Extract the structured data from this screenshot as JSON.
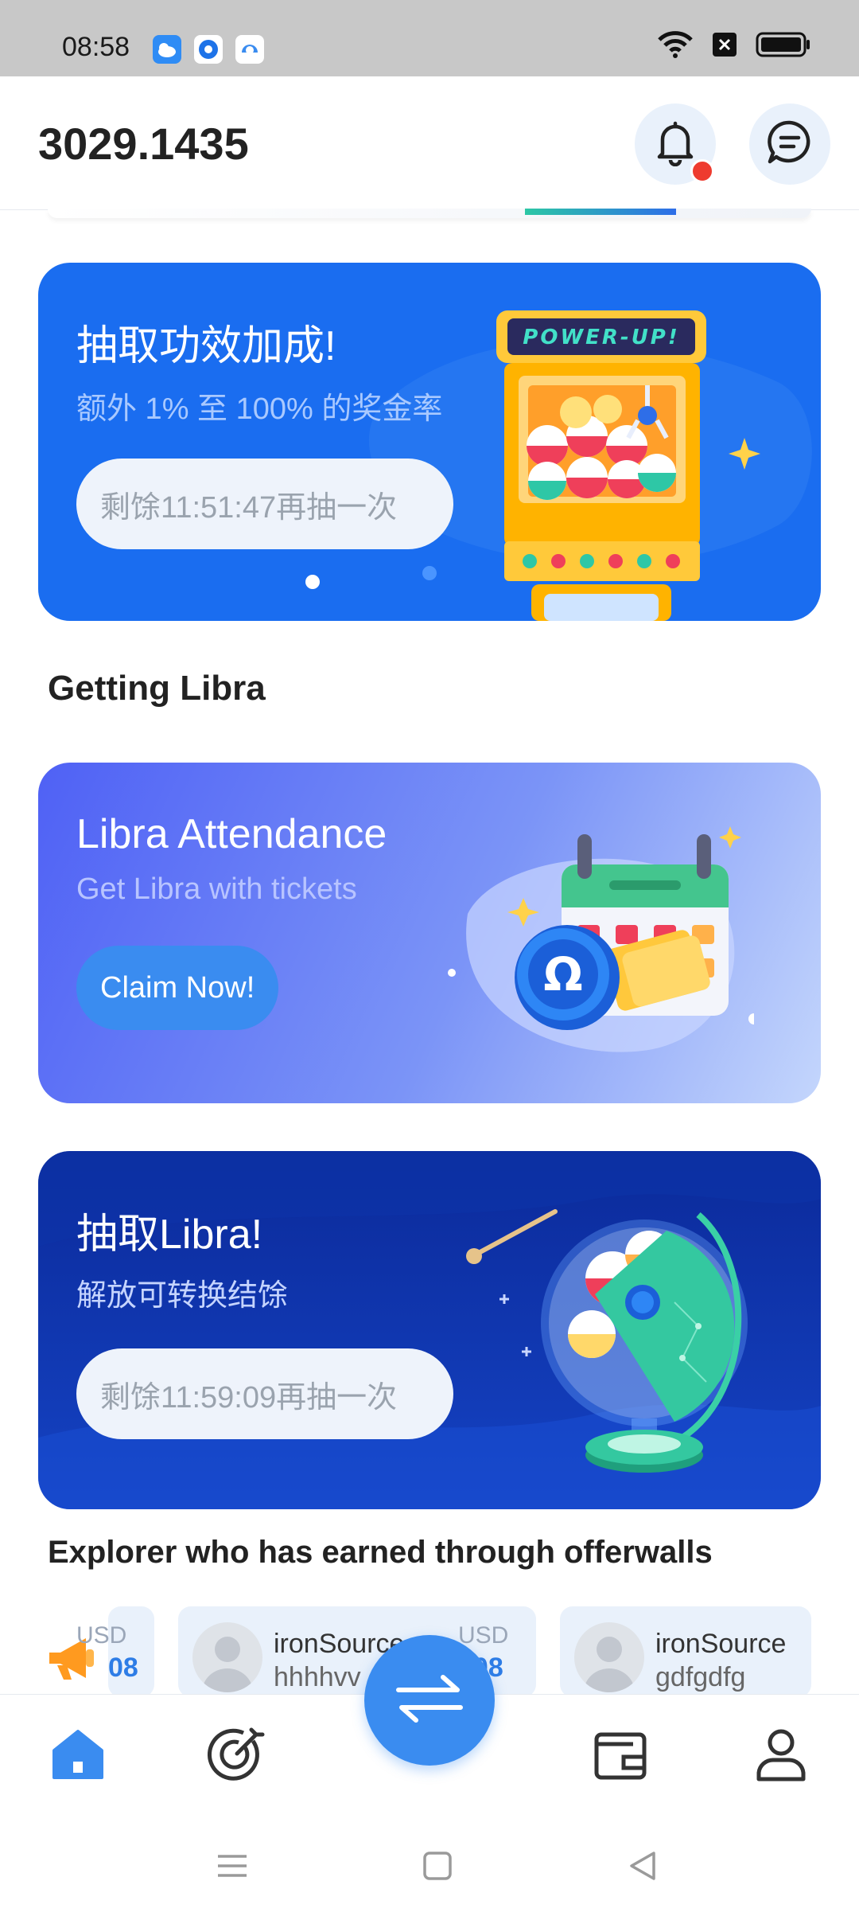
{
  "status_bar": {
    "time": "08:58"
  },
  "header": {
    "balance": "3029.1435"
  },
  "banners": {
    "power_up": {
      "title": "抽取功效加成!",
      "subtitle": "额外 1% 至 100% 的奖金率",
      "button": "剩馀11:51:47再抽一次",
      "machine_sign": "POWER-UP!"
    },
    "getting_title": "Getting Libra",
    "attendance": {
      "title": "Libra Attendance",
      "subtitle": "Get Libra with tickets",
      "button": "Claim Now!"
    },
    "draw_libra": {
      "title": "抽取Libra!",
      "subtitle": "解放可转换结馀",
      "button": "剩馀11:59:09再抽一次"
    }
  },
  "explorers": {
    "title": "Explorer who has earned through offerwalls",
    "items": [
      {
        "cur": "USD",
        "amt": "08"
      },
      {
        "name": "ironSource",
        "user": "hhhhvv",
        "cur": "USD",
        "amt": "608"
      },
      {
        "name": "ironSource",
        "user": "gdfgdfg"
      }
    ]
  },
  "colors": {
    "primary": "#3a8cf0",
    "banner1": "#1a6df0",
    "banner3": "#0b2a9a",
    "notification_dot": "#ee3b2f"
  },
  "icons": {
    "bell": "bell-icon",
    "chat": "chat-icon",
    "home": "home-icon",
    "target": "target-icon",
    "exchange": "exchange-icon",
    "wallet": "wallet-icon",
    "profile": "profile-icon",
    "megaphone": "megaphone-icon"
  }
}
